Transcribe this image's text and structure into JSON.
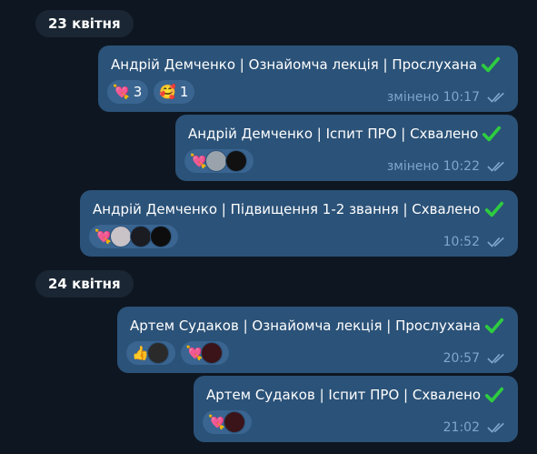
{
  "dates": [
    "23 квітня",
    "24 квітня"
  ],
  "messages": [
    {
      "text": "Андрій Демченко | Ознайомча лекція | Прослухана",
      "time": "змінено 10:17",
      "reactions": [
        {
          "emoji": "💘",
          "count": "3"
        },
        {
          "emoji": "🥰",
          "count": "1"
        }
      ]
    },
    {
      "text": "Андрій Демченко | Іспит ПРО | Схвалено",
      "time": "змінено 10:22",
      "reactions": [
        {
          "emoji": "💘"
        }
      ]
    },
    {
      "text": "Андрій Демченко | Підвищення 1-2 звання | Схвалено",
      "time": "10:52",
      "reactions": [
        {
          "emoji": "💘"
        }
      ]
    },
    {
      "text": "Артем Судаков | Ознайомча лекція | Прослухана",
      "time": "20:57",
      "reactions": [
        {
          "emoji": "👍"
        },
        {
          "emoji": "💘"
        }
      ]
    },
    {
      "text": "Артем Судаков | Іспит ПРО | Схвалено",
      "time": "21:02",
      "reactions": [
        {
          "emoji": "💘"
        }
      ]
    }
  ],
  "icons": {
    "check": "check-mark-icon",
    "read": "double-check-icon"
  },
  "colors": {
    "background": "#0e1621",
    "bubble": "#2b5278",
    "reaction": "#3a6591",
    "check": "#2ecc40",
    "meta": "#7ea6cf"
  }
}
